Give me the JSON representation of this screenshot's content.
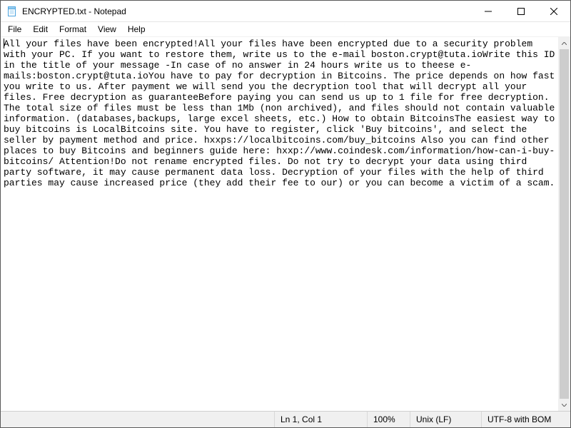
{
  "window": {
    "title": "ENCRYPTED.txt - Notepad"
  },
  "menu": {
    "file": "File",
    "edit": "Edit",
    "format": "Format",
    "view": "View",
    "help": "Help"
  },
  "document": {
    "text": "All your files have been encrypted!All your files have been encrypted due to a security problem with your PC. If you want to restore them, write us to the e-mail boston.crypt@tuta.ioWrite this ID in the title of your message -In case of no answer in 24 hours write us to theese e-mails:boston.crypt@tuta.ioYou have to pay for decryption in Bitcoins. The price depends on how fast you write to us. After payment we will send you the decryption tool that will decrypt all your files. Free decryption as guaranteeBefore paying you can send us up to 1 file for free decryption. The total size of files must be less than 1Mb (non archived), and files should not contain valuable information. (databases,backups, large excel sheets, etc.) How to obtain BitcoinsThe easiest way to buy bitcoins is LocalBitcoins site. You have to register, click 'Buy bitcoins', and select the seller by payment method and price. hxxps://localbitcoins.com/buy_bitcoins Also you can find other places to buy Bitcoins and beginners guide here: hxxp://www.coindesk.com/information/how-can-i-buy-bitcoins/ Attention!Do not rename encrypted files. Do not try to decrypt your data using third party software, it may cause permanent data loss. Decryption of your files with the help of third parties may cause increased price (they add their fee to our) or you can become a victim of a scam."
  },
  "status": {
    "position": "Ln 1, Col 1",
    "zoom": "100%",
    "eol": "Unix (LF)",
    "encoding": "UTF-8 with BOM"
  }
}
